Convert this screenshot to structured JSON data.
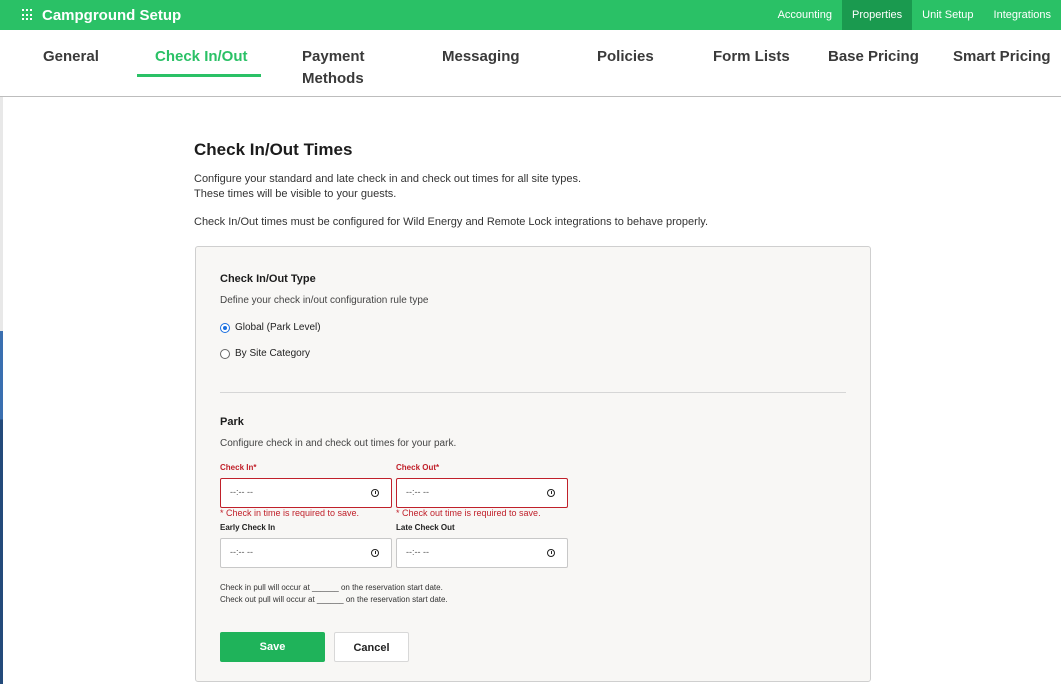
{
  "app": {
    "title": "Campground Setup",
    "topnav": [
      "Accounting",
      "Properties",
      "Unit Setup",
      "Integrations"
    ],
    "active_topnav": "Properties"
  },
  "tabs": {
    "general": "General",
    "checkinout": "Check In/Out",
    "payment_line1": "Payment",
    "payment_line2": "Methods",
    "messaging": "Messaging",
    "policies": "Policies",
    "formlists": "Form Lists",
    "basepricing": "Base Pricing",
    "smartpricing": "Smart Pricing",
    "active": "Check In/Out"
  },
  "page": {
    "title": "Check In/Out Times",
    "desc_line1": "Configure your standard and late check in and check out times for all site types.",
    "desc_line2": "These times will be visible to your guests.",
    "desc_line3": "Check In/Out times must be configured for Wild Energy and Remote Lock integrations to behave properly."
  },
  "type_section": {
    "title": "Check In/Out Type",
    "description": "Define your check in/out configuration rule type",
    "options": [
      "Global (Park Level)",
      "By Site Category"
    ],
    "selected": "Global (Park Level)"
  },
  "park_section": {
    "title": "Park",
    "description": "Configure check in and check out times for your park.",
    "check_in": {
      "label": "Check In*",
      "placeholder": "--:-- --",
      "error": "* Check in time is required to save."
    },
    "check_out": {
      "label": "Check Out*",
      "placeholder": "--:-- --",
      "error": "* Check out time is required to save."
    },
    "early_check_in": {
      "label": "Early Check In",
      "placeholder": "--:-- --"
    },
    "late_check_out": {
      "label": "Late Check Out",
      "placeholder": "--:-- --"
    },
    "pull_in_text": "Check in pull will occur at ______ on the reservation start date.",
    "pull_out_text": "Check out pull will occur at ______ on the reservation start date."
  },
  "buttons": {
    "save": "Save",
    "cancel": "Cancel"
  },
  "colors": {
    "brand_green": "#2ac166",
    "active_topnav": "#1a9a4f",
    "error_red": "#c0202a",
    "save_green": "#1fb35a"
  }
}
